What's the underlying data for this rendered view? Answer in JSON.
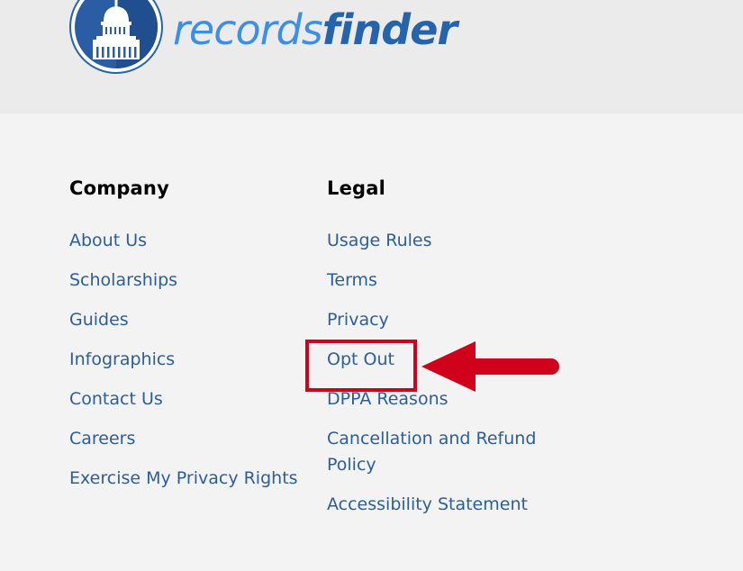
{
  "header": {
    "logo": {
      "icon": "capitol-dome-icon",
      "text_light": "records",
      "text_bold": "finder"
    }
  },
  "footer": {
    "company": {
      "heading": "Company",
      "links": [
        "About Us",
        "Scholarships",
        "Guides",
        "Infographics",
        "Contact Us",
        "Careers",
        "Exercise My Privacy Rights"
      ]
    },
    "legal": {
      "heading": "Legal",
      "links": [
        "Usage Rules",
        "Terms",
        "Privacy",
        "Opt Out",
        "DPPA Reasons",
        "Cancellation and Refund Policy",
        "Accessibility Statement"
      ]
    }
  },
  "annotation": {
    "highlighted_link": "Opt Out",
    "color": "#d0021b",
    "arrow_icon": "left-arrow-icon"
  },
  "colors": {
    "link": "#2c5e9e",
    "logo_light": "#3d8fe6",
    "logo_dark": "#2563aa",
    "header_bg": "#ebebeb",
    "page_bg": "#f3f3f3"
  }
}
